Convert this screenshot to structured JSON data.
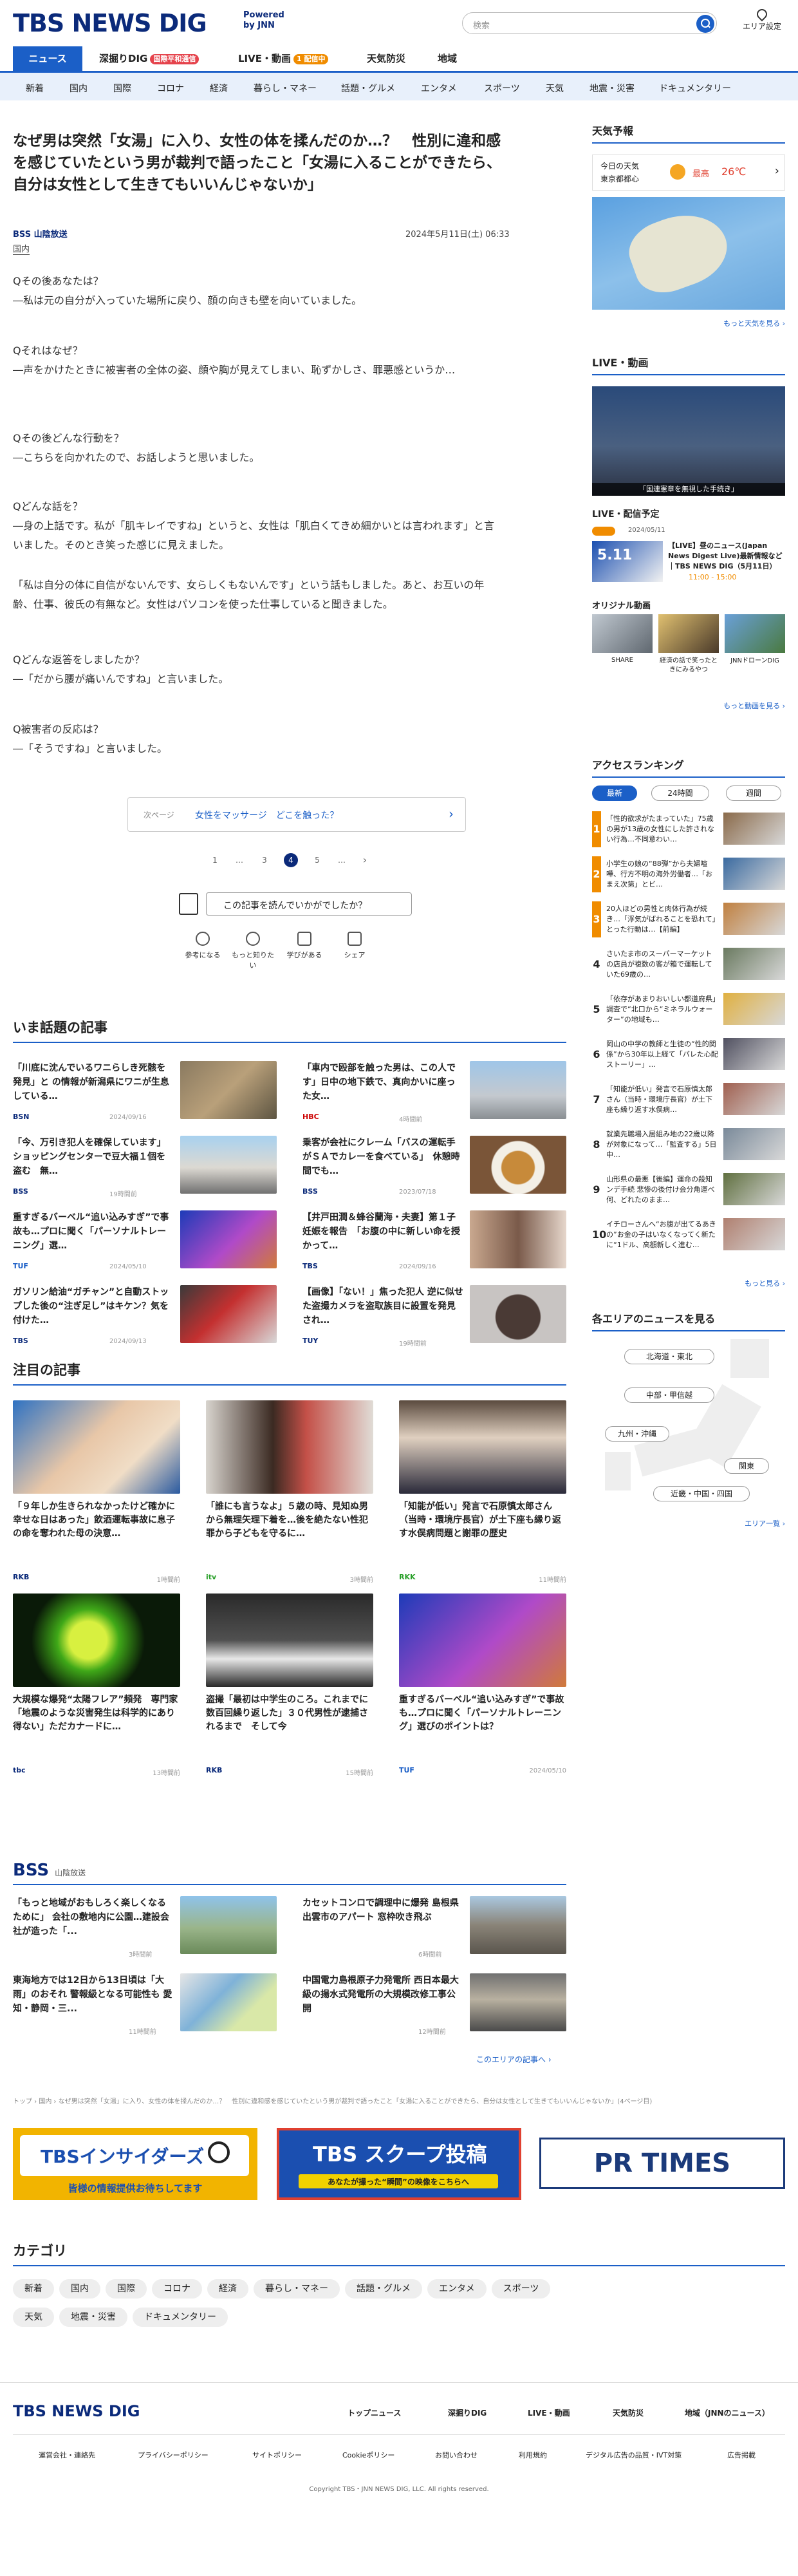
{
  "header": {
    "logo": "TBS NEWS DIG",
    "powered": "Powered",
    "by": "by JNN",
    "search_placeholder": "検索",
    "area_label": "エリア設定"
  },
  "tabs": [
    {
      "label": "ニュース"
    },
    {
      "label": "深掘りDIG",
      "badge": "国際平和通信"
    },
    {
      "label": "LIVE・動画",
      "badge": "1 配信中"
    },
    {
      "label": "天気防災"
    },
    {
      "label": "地域"
    }
  ],
  "categories": [
    "新着",
    "国内",
    "国際",
    "コロナ",
    "経済",
    "暮らし・マネー",
    "話題・グルメ",
    "エンタメ",
    "スポーツ",
    "天気",
    "地震・災害",
    "ドキュメンタリー"
  ],
  "article": {
    "title": "なぜ男は突然「女湯」に入り、女性の体を揉んだのか…？　性別に違和感を感じていたという男が裁判で語ったこと「女湯に入ることができたら、自分は女性として生きてもいいんじゃないか」",
    "source": "BSS 山陰放送",
    "date": "2024年5月11日(土) 06:33",
    "category": "国内",
    "paragraphs": [
      "Qその後あなたは？",
      "―私は元の自分が入っていた場所に戻り、顔の向きも壁を向いていました。",
      "Qそれはなぜ？",
      "―声をかけたときに被害者の全体の姿、顔や胸が見えてしまい、恥ずかしさ、罪悪感というか…",
      "Qその後どんな行動を？",
      "―こちらを向かれたので、お話しようと思いました。",
      "Qどんな話を？",
      "―身の上話です。私が「肌キレイですね」というと、女性は「肌白くてきめ細かいとは言われます」と言いました。そのとき笑った感じに見えました。",
      "「私は自分の体に自信がないんです、女らしくもないんです」という話もしました。あと、お互いの年齢、仕事、彼氏の有無など。女性はパソコンを使った仕事していると聞きました。",
      "Qどんな返答をしましたか？",
      "―「だから腰が痛いんですね」と言いました。",
      "Q被害者の反応は？",
      "―「そうですね」と言いました。"
    ],
    "next_label": "次ページ",
    "next_title": "女性をマッサージ　どこを触った？",
    "pages": [
      "1",
      "…",
      "3",
      "4",
      "5",
      "…"
    ],
    "feedback": "この記事を読んでいかがでしたか？",
    "reactions": [
      "参考になる",
      "もっと知りたい",
      "学びがある",
      "シェア"
    ]
  },
  "trending": {
    "title": "いま話題の記事",
    "items": [
      {
        "text": "「川底に沈んでいるワニらしき死骸を発見」と の情報が新潟県にワニが生息している…",
        "src": "BSN",
        "time": "2024/09/16"
      },
      {
        "text": "「車内で殴部を触った男は、この人です」日中の地下鉄で、真向かいに座った女…",
        "src": "HBC",
        "time": "4時間前"
      },
      {
        "text": "「今、万引き犯人を確保しています」ショッピングセンターで豆大福１個を盗む　無…",
        "src": "BSS",
        "time": "19時間前"
      },
      {
        "text": "乗客が会社にクレーム「バスの運転手がＳＡでカレーを食べている」　休憩時間でも…",
        "src": "BSS",
        "time": "2023/07/18"
      },
      {
        "text": "重すぎるバーベル“追い込みすぎ”で事故も…プロに聞く「パーソナルトレーニング」選…",
        "src": "TUF",
        "time": "2024/05/10"
      },
      {
        "text": "【井戸田潤＆蜂谷蘭海・夫妻】第１子妊娠を報告　「お腹の中に新しい命を授かって…",
        "src": "TBS",
        "time": "2024/09/16"
      },
      {
        "text": "ガソリン給油“ガチャン”と自動ストップした後の“注ぎ足し”はキケン？気を付けた…",
        "src": "TBS",
        "time": "2024/09/13"
      },
      {
        "text": "【画像】「ない！」焦った犯人 逆に似せた盗撮カメラを盗取族目に設置を発見され…",
        "src": "TUY",
        "time": "19時間前"
      }
    ]
  },
  "featured": {
    "title": "注目の記事",
    "items": [
      {
        "text": "「９年しか生きられなかったけど確かに幸せな日はあった」飲酒運転事故に息子の命を奪われた母の決意…",
        "src": "RKB",
        "time": "1時間前"
      },
      {
        "text": "「誰にも言うなよ」５歳の時、見知ぬ男から無理矢理下着を…後を絶たない性犯罪から子どもを守るに…",
        "src": "itv",
        "time": "3時間前"
      },
      {
        "text": "「知能が低い」発言で石原慎太郎さん（当時・環境庁長官）が土下座も縁り返す水俣病問題と謝罪の歴史",
        "src": "RKK",
        "time": "11時間前"
      },
      {
        "text": "大規模な爆発“太陽フレア”頻発　専門家「地震のような災害発生は科学的にあり得ない」ただカナードに…",
        "src": "tbc",
        "time": "13時間前"
      },
      {
        "text": "盗撮「最初は中学生のころ。これまでに数百回繰り返した」３０代男性が逮捕されるまで　そして今",
        "src": "RKB",
        "time": "15時間前"
      },
      {
        "text": "重すぎるバーベル“追い込みすぎ”で事故も…プロに聞く「パーソナルトレーニング」選びのポイントは？",
        "src": "TUF",
        "time": "2024/05/10"
      }
    ]
  },
  "bss": {
    "name": "BSS",
    "full": "山陰放送",
    "items": [
      {
        "text": "「もっと地域がおもしろく楽しくなるために」 会社の敷地内に公園…建設会社が造った「...",
        "time": "3時間前"
      },
      {
        "text": "カセットコンロで調理中に爆発 島根県出雲市のアパート 窓枠吹き飛ぶ",
        "time": "6時間前"
      },
      {
        "text": "東海地方では12日から13日頃は「大雨」のおそれ 警報級となる可能性も 愛知・静岡・三...",
        "time": "11時間前"
      },
      {
        "text": "中国電力島根原子力発電所 西日本最大級の揚水式発電所の大規模改修工事公開",
        "time": "12時間前"
      }
    ],
    "more": "このエリアの記事へ ›"
  },
  "breadcrumb": "トップ › 国内 › なぜ男は突然「女湯」に入り、女性の体を揉んだのか…？　性別に違和感を感じていたという男が裁判で語ったこと「女湯に入ることができたら、自分は女性として生きてもいいんじゃないか」(4ページ目)",
  "ads": [
    {
      "title": "TBSインサイダーズ",
      "sub": "皆様の情報提供お待ちしてます"
    },
    {
      "title": "TBS スクープ投稿",
      "sub": "あなたが撮った“瞬間”の映像をこちらへ"
    },
    {
      "title": "PR TIMES"
    }
  ],
  "category_section": {
    "title": "カテゴリ",
    "items": [
      "新着",
      "国内",
      "国際",
      "コロナ",
      "経済",
      "暮らし・マネー",
      "話題・グルメ",
      "エンタメ",
      "スポーツ",
      "天気",
      "地震・災害",
      "ドキュメンタリー"
    ]
  },
  "sidebar": {
    "weather": {
      "title": "天気予報",
      "today": "今日の天気",
      "place": "東京都都心",
      "high_label": "最高",
      "high": "26℃",
      "more": "もっと天気を見る ›"
    },
    "live": {
      "title": "LIVE・動画",
      "caption": "「国連憲章を無視した手続き」",
      "more_title": "LIVE・配信予定",
      "live_date": "2024/05/11",
      "live_text": "【LIVE】昼のニュース(Japan News Digest Live)最新情報など｜TBS NEWS DIG（5月11日）",
      "live_time": "11:00 - 15:00",
      "sched_date": "5.11",
      "orig": "オリジナル動画",
      "videos": [
        "SHARE",
        "経済の話で笑ったときにみるやつ",
        "JNNドローンDIG"
      ],
      "more": "もっと動画を見る ›"
    },
    "ranking": {
      "title": "アクセスランキング",
      "tabs": [
        "最新",
        "24時間",
        "週間"
      ],
      "items": [
        "「性的欲求がたまっていた」75歳の男が13歳の女性にした許されない行為…不同意わい…",
        "小学生の娘の“88弾”から夫婦喧嘩、行方不明の海外労働者…「おまえ次第」とビ…",
        "20人ほどの男性と肉体行為が続き…「浮気がばれることを恐れて」とった行動は…【前編】",
        "さいたま市のスーパーマーケットの店員が複数の客が箱で運転していた69歳の…",
        "「依存があまりおいしい都道府県」調査で“北口から“ミネラルウォーター”の地域も…",
        "岡山の中学の教師と生徒の“性的関係”から30年以上経て「パレた心配ストーリー」…",
        "「知能が低い」発言で石原慎太郎さん（当時・環境庁長官）が土下座も繰り返す水俣病…",
        "就業先職場入居組み地の22歳以降が対象になって…「監査する」5日中…",
        "山形県の最悪【後編】運命の殺知ンデ手続 悲惨の後付け会分角運べ何、どれたのまま…",
        "イチローさんへ“お腹が出てるあきの”お金の子はいなくなってく新たに“1ドル、高額新しく進む…"
      ],
      "more": "もっと見る ›"
    },
    "area": {
      "title": "各エリアのニュースを見る",
      "regions": [
        "北海道・東北",
        "中部・甲信越",
        "九州・沖縄",
        "関東",
        "近畿・中国・四国"
      ],
      "more": "エリア一覧 ›"
    }
  },
  "footer": {
    "logo": "TBS NEWS DIG",
    "nav": [
      "トップニュース",
      "深掘りDIG",
      "LIVE・動画",
      "天気防災",
      "地域（JNNのニュース）"
    ],
    "links": [
      "運営会社・連絡先",
      "プライバシーポリシー",
      "サイトポリシー",
      "Cookieポリシー",
      "お問い合わせ",
      "利用規約",
      "デジタル広告の品質・IVT対策",
      "広告掲載"
    ],
    "copyright": "Copyright TBS・JNN NEWS DIG, LLC. All rights reserved."
  }
}
